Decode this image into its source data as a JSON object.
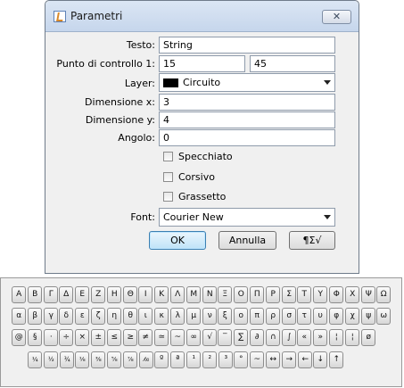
{
  "window": {
    "title": "Parametri",
    "close_symbol": "✕"
  },
  "form": {
    "testo": {
      "label": "Testo:",
      "value": "String"
    },
    "punto": {
      "label": "Punto di controllo 1:",
      "x": "15",
      "y": "45"
    },
    "layer": {
      "label": "Layer:",
      "value": "Circuito",
      "swatch_color": "#000000"
    },
    "dim_x": {
      "label": "Dimensione x:",
      "value": "3"
    },
    "dim_y": {
      "label": "Dimensione y:",
      "value": "4"
    },
    "angolo": {
      "label": "Angolo:",
      "value": "0"
    },
    "specchiato": {
      "label": "Specchiato",
      "checked": false
    },
    "corsivo": {
      "label": "Corsivo",
      "checked": false
    },
    "grassetto": {
      "label": "Grassetto",
      "checked": false
    },
    "font": {
      "label": "Font:",
      "value": "Courier New"
    }
  },
  "buttons": {
    "ok": "OK",
    "annulla": "Annulla",
    "symbols": "¶Σ√"
  },
  "palette": {
    "rows": [
      [
        "Α",
        "Β",
        "Γ",
        "Δ",
        "Ε",
        "Ζ",
        "Η",
        "Θ",
        "Ι",
        "Κ",
        "Λ",
        "Μ",
        "Ν",
        "Ξ",
        "Ο",
        "Π",
        "Ρ",
        "Σ",
        "Τ",
        "Υ",
        "Φ",
        "Χ",
        "Ψ",
        "Ω"
      ],
      [
        "α",
        "β",
        "γ",
        "δ",
        "ε",
        "ζ",
        "η",
        "θ",
        "ι",
        "κ",
        "λ",
        "μ",
        "ν",
        "ξ",
        "ο",
        "π",
        "ρ",
        "σ",
        "τ",
        "υ",
        "φ",
        "χ",
        "ψ",
        "ω"
      ],
      [
        "@",
        "§",
        "·",
        "÷",
        "×",
        "±",
        "≤",
        "≥",
        "≠",
        "≃",
        "~",
        "∞",
        "√",
        "‾",
        "∑",
        "∂",
        "∩",
        "∫",
        "«",
        "»",
        "¦",
        "¦",
        "ø"
      ],
      [
        "¼",
        "½",
        "¾",
        "⅛",
        "⅜",
        "⅝",
        "⅞",
        "⁄₀₀",
        "º",
        "ª",
        "¹",
        "²",
        "³",
        "°",
        "~",
        "↔",
        "→",
        "←",
        "↓",
        "↑"
      ]
    ]
  }
}
